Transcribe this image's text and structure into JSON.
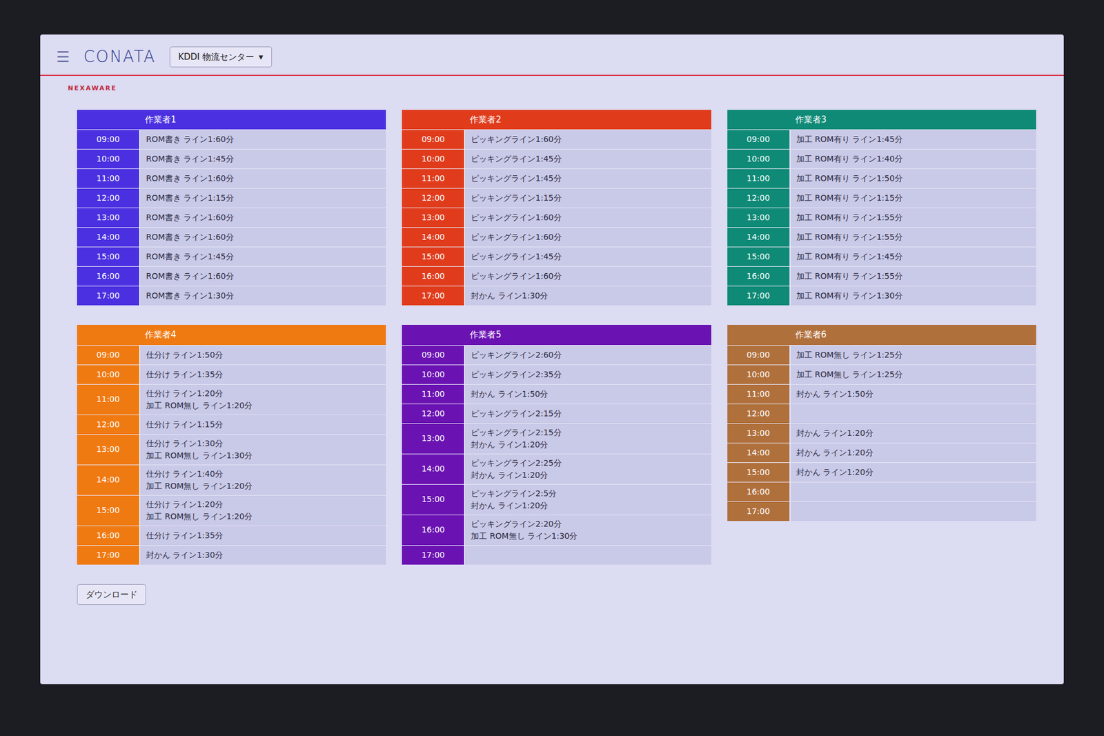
{
  "header": {
    "menu_icon": "☰",
    "logo": "CONATA",
    "site_select": {
      "value": "KDDI 物流センター",
      "caret": "▾"
    },
    "brand": "NEXAWARE"
  },
  "workers": [
    {
      "name": "作業者1",
      "color": "#4a30e0",
      "slots": [
        {
          "time": "09:00",
          "tasks": [
            "ROM書き ライン1:60分"
          ]
        },
        {
          "time": "10:00",
          "tasks": [
            "ROM書き ライン1:45分"
          ]
        },
        {
          "time": "11:00",
          "tasks": [
            "ROM書き ライン1:60分"
          ]
        },
        {
          "time": "12:00",
          "tasks": [
            "ROM書き ライン1:15分"
          ]
        },
        {
          "time": "13:00",
          "tasks": [
            "ROM書き ライン1:60分"
          ]
        },
        {
          "time": "14:00",
          "tasks": [
            "ROM書き ライン1:60分"
          ]
        },
        {
          "time": "15:00",
          "tasks": [
            "ROM書き ライン1:45分"
          ]
        },
        {
          "time": "16:00",
          "tasks": [
            "ROM書き ライン1:60分"
          ]
        },
        {
          "time": "17:00",
          "tasks": [
            "ROM書き ライン1:30分"
          ]
        }
      ]
    },
    {
      "name": "作業者2",
      "color": "#e03c1c",
      "slots": [
        {
          "time": "09:00",
          "tasks": [
            "ピッキングライン1:60分"
          ]
        },
        {
          "time": "10:00",
          "tasks": [
            "ピッキングライン1:45分"
          ]
        },
        {
          "time": "11:00",
          "tasks": [
            "ピッキングライン1:45分"
          ]
        },
        {
          "time": "12:00",
          "tasks": [
            "ピッキングライン1:15分"
          ]
        },
        {
          "time": "13:00",
          "tasks": [
            "ピッキングライン1:60分"
          ]
        },
        {
          "time": "14:00",
          "tasks": [
            "ピッキングライン1:60分"
          ]
        },
        {
          "time": "15:00",
          "tasks": [
            "ピッキングライン1:45分"
          ]
        },
        {
          "time": "16:00",
          "tasks": [
            "ピッキングライン1:60分"
          ]
        },
        {
          "time": "17:00",
          "tasks": [
            "封かん ライン1:30分"
          ]
        }
      ]
    },
    {
      "name": "作業者3",
      "color": "#0e8a76",
      "slots": [
        {
          "time": "09:00",
          "tasks": [
            "加工 ROM有り ライン1:45分"
          ]
        },
        {
          "time": "10:00",
          "tasks": [
            "加工 ROM有り ライン1:40分"
          ]
        },
        {
          "time": "11:00",
          "tasks": [
            "加工 ROM有り ライン1:50分"
          ]
        },
        {
          "time": "12:00",
          "tasks": [
            "加工 ROM有り ライン1:15分"
          ]
        },
        {
          "time": "13:00",
          "tasks": [
            "加工 ROM有り ライン1:55分"
          ]
        },
        {
          "time": "14:00",
          "tasks": [
            "加工 ROM有り ライン1:55分"
          ]
        },
        {
          "time": "15:00",
          "tasks": [
            "加工 ROM有り ライン1:45分"
          ]
        },
        {
          "time": "16:00",
          "tasks": [
            "加工 ROM有り ライン1:55分"
          ]
        },
        {
          "time": "17:00",
          "tasks": [
            "加工 ROM有り ライン1:30分"
          ]
        }
      ]
    },
    {
      "name": "作業者4",
      "color": "#f07a12",
      "slots": [
        {
          "time": "09:00",
          "tasks": [
            "仕分け ライン1:50分"
          ]
        },
        {
          "time": "10:00",
          "tasks": [
            "仕分け ライン1:35分"
          ]
        },
        {
          "time": "11:00",
          "tasks": [
            "仕分け ライン1:20分",
            "加工 ROM無し ライン1:20分"
          ]
        },
        {
          "time": "12:00",
          "tasks": [
            "仕分け ライン1:15分"
          ]
        },
        {
          "time": "13:00",
          "tasks": [
            "仕分け ライン1:30分",
            "加工 ROM無し ライン1:30分"
          ]
        },
        {
          "time": "14:00",
          "tasks": [
            "仕分け ライン1:40分",
            "加工 ROM無し ライン1:20分"
          ]
        },
        {
          "time": "15:00",
          "tasks": [
            "仕分け ライン1:20分",
            "加工 ROM無し ライン1:20分"
          ]
        },
        {
          "time": "16:00",
          "tasks": [
            "仕分け ライン1:35分"
          ]
        },
        {
          "time": "17:00",
          "tasks": [
            "封かん ライン1:30分"
          ]
        }
      ]
    },
    {
      "name": "作業者5",
      "color": "#6a12b2",
      "slots": [
        {
          "time": "09:00",
          "tasks": [
            "ピッキングライン2:60分"
          ]
        },
        {
          "time": "10:00",
          "tasks": [
            "ピッキングライン2:35分"
          ]
        },
        {
          "time": "11:00",
          "tasks": [
            "封かん ライン1:50分"
          ]
        },
        {
          "time": "12:00",
          "tasks": [
            "ピッキングライン2:15分"
          ]
        },
        {
          "time": "13:00",
          "tasks": [
            "ピッキングライン2:15分",
            "封かん ライン1:20分"
          ]
        },
        {
          "time": "14:00",
          "tasks": [
            "ピッキングライン2:25分",
            "封かん ライン1:20分"
          ]
        },
        {
          "time": "15:00",
          "tasks": [
            "ピッキングライン2:5分",
            "封かん ライン1:20分"
          ]
        },
        {
          "time": "16:00",
          "tasks": [
            "ピッキングライン2:20分",
            "加工 ROM無し ライン1:30分"
          ]
        },
        {
          "time": "17:00",
          "tasks": []
        }
      ]
    },
    {
      "name": "作業者6",
      "color": "#b0703c",
      "slots": [
        {
          "time": "09:00",
          "tasks": [
            "加工 ROM無し ライン1:25分"
          ]
        },
        {
          "time": "10:00",
          "tasks": [
            "加工 ROM無し ライン1:25分"
          ]
        },
        {
          "time": "11:00",
          "tasks": [
            "封かん ライン1:50分"
          ]
        },
        {
          "time": "12:00",
          "tasks": []
        },
        {
          "time": "13:00",
          "tasks": [
            "封かん ライン1:20分"
          ]
        },
        {
          "time": "14:00",
          "tasks": [
            "封かん ライン1:20分"
          ]
        },
        {
          "time": "15:00",
          "tasks": [
            "封かん ライン1:20分"
          ]
        },
        {
          "time": "16:00",
          "tasks": []
        },
        {
          "time": "17:00",
          "tasks": []
        }
      ]
    }
  ],
  "download_button": "ダウンロード"
}
